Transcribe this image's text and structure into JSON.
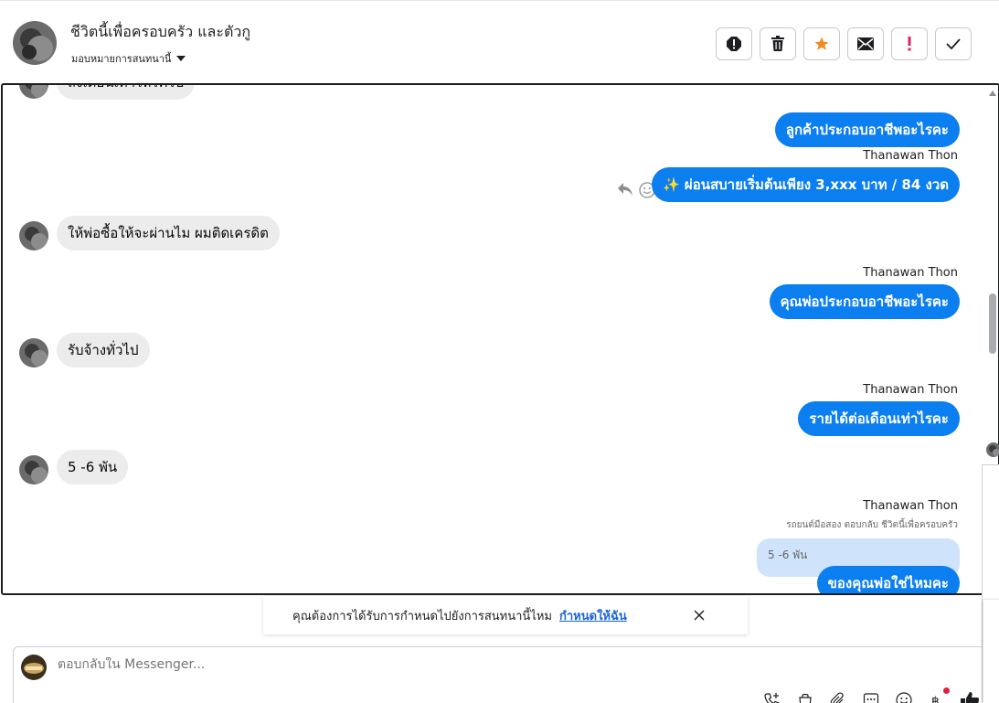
{
  "header": {
    "title": "ชีวิตนี้เพื่อครอบครัว และตัวกู",
    "assign_label": "มอบหมายการสนทนานี้"
  },
  "messages": {
    "partial_top": "ส่งเดือนเท่าไหร่ครับ",
    "out1": "ลูกค้าประกอบอาชีพอะไรคะ",
    "sender1": "Thanawan Thon",
    "out2": "✨ ผ่อนสบายเริ่มต้นเพียง 3,xxx บาท / 84 งวด",
    "in1": "ให้พ่อซื้อให้จะผ่านไม  ผมติดเครดิต",
    "sender2": "Thanawan Thon",
    "out3": "คุณพ่อประกอบอาชีพอะไรคะ",
    "in2": "รับจ้างทั่วไป",
    "sender3": "Thanawan Thon",
    "out4": "รายได้ต่อเดือนเท่าไรคะ",
    "in3": "5 -6 พัน",
    "sender4": "Thanawan Thon",
    "reply_note": "รถยนต์มือสอง ตอบกลับ ชีวิตนี้เพื่อครอบครัว",
    "quoted": "5 -6 พัน",
    "out5": "ของคุณพ่อใช่ไหมคะ"
  },
  "suggestion": {
    "text": "คุณต้องการได้รับการกำหนดไปยังการสนทนานี้ไหม",
    "link": "กำหนดให้ฉัน"
  },
  "composer": {
    "placeholder": "ตอบกลับใน Messenger..."
  },
  "colors": {
    "outgoing_bubble": "#0b7ef0",
    "incoming_bubble": "#ececec",
    "star": "#f08a24",
    "exclaim": "#e0245e",
    "link": "#1a64d6"
  },
  "icons": [
    "report-icon",
    "trash-icon",
    "star-icon",
    "envelope-icon",
    "important-icon",
    "check-icon",
    "reply-icon",
    "emoji-react-icon",
    "call-add-icon",
    "shop-icon",
    "attach-icon",
    "saved-reply-icon",
    "emoji-icon",
    "baht-icon",
    "like-icon",
    "close-icon"
  ]
}
